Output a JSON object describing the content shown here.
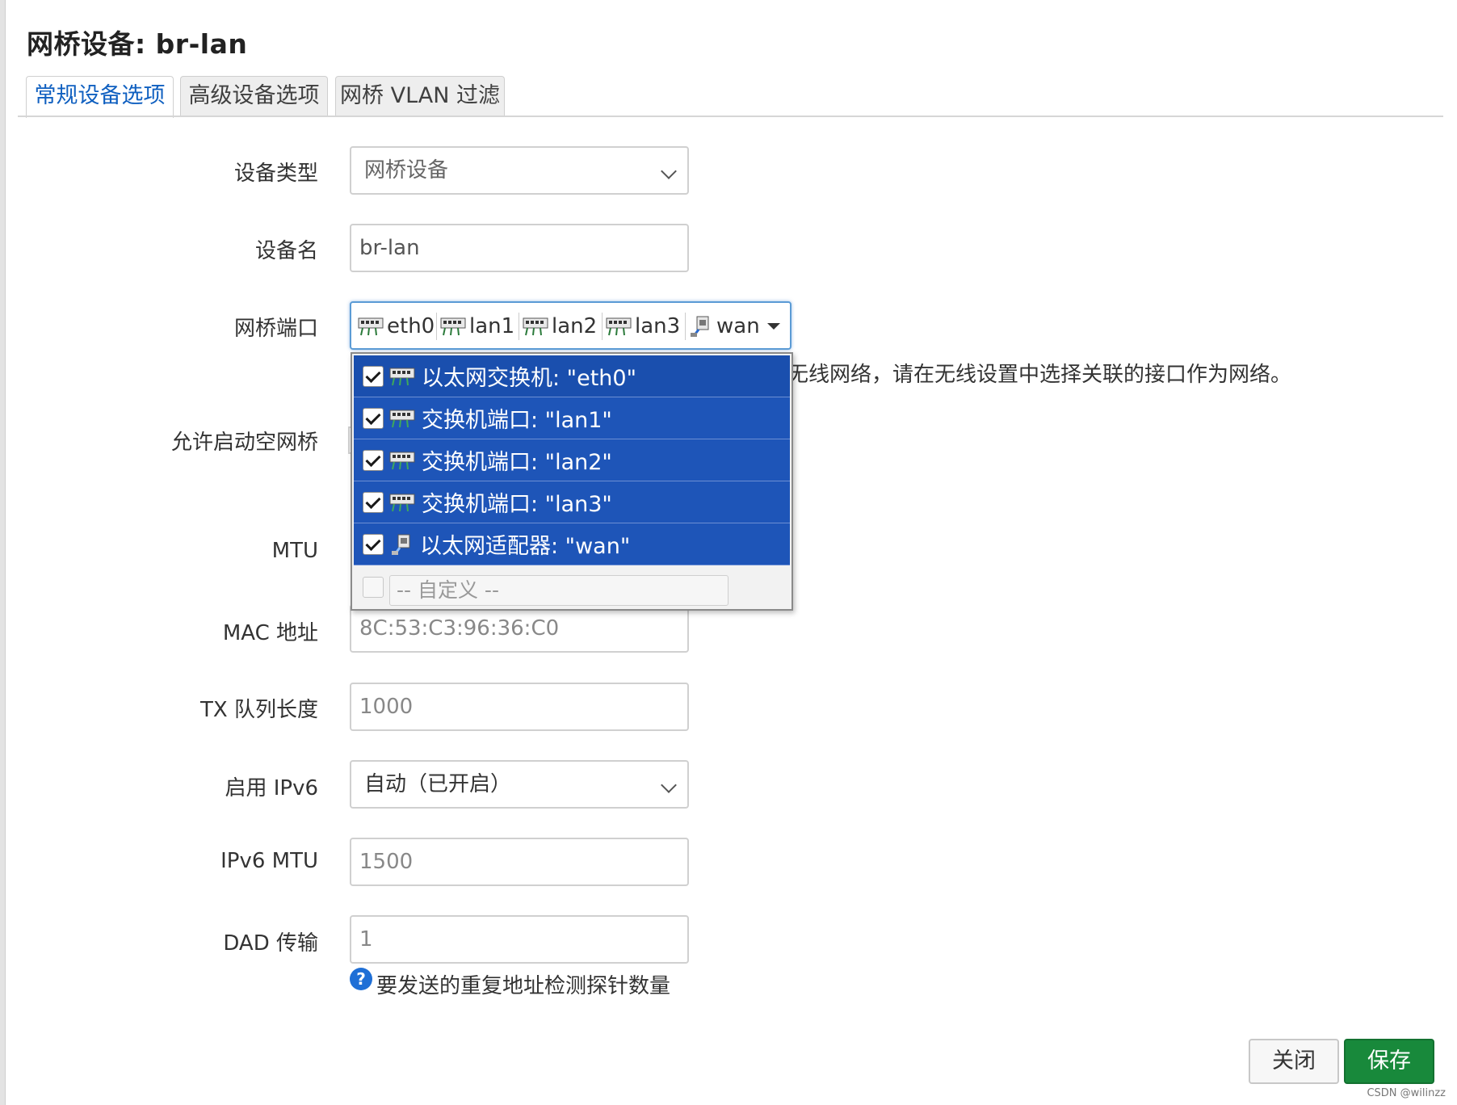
{
  "dialog": {
    "title": "网桥设备: br-lan"
  },
  "tabs": [
    {
      "label": "常规设备选项",
      "active": true
    },
    {
      "label": "高级设备选项",
      "active": false
    },
    {
      "label": "网桥 VLAN 过滤",
      "active": false
    }
  ],
  "form": {
    "device_type": {
      "label": "设备类型",
      "value": "网桥设备"
    },
    "device_name": {
      "label": "设备名",
      "value": "br-lan"
    },
    "bridge_ports": {
      "label": "网桥端口",
      "selected": [
        "eth0",
        "lan1",
        "lan2",
        "lan3",
        "wan"
      ],
      "hint": "无线网络，请在无线设置中选择关联的接口作为网络。"
    },
    "bring_up_empty": {
      "label": "允许启动空网桥"
    },
    "mtu": {
      "label": "MTU"
    },
    "mac_address": {
      "label": "MAC 地址",
      "placeholder": "8C:53:C3:96:36:C0"
    },
    "tx_queue": {
      "label": "TX 队列长度",
      "placeholder": "1000"
    },
    "enable_ipv6": {
      "label": "启用 IPv6",
      "value": "自动（已开启）"
    },
    "ipv6_mtu": {
      "label": "IPv6 MTU",
      "placeholder": "1500"
    },
    "dad_transmits": {
      "label": "DAD 传输",
      "placeholder": "1",
      "help": "要发送的重复地址检测探针数量"
    }
  },
  "dropdown": {
    "options": [
      {
        "label": "以太网交换机: \"eth0\"",
        "checked": true,
        "icon": "switch-icon"
      },
      {
        "label": "交换机端口: \"lan1\"",
        "checked": true,
        "icon": "switch-icon"
      },
      {
        "label": "交换机端口: \"lan2\"",
        "checked": true,
        "icon": "switch-icon"
      },
      {
        "label": "交换机端口: \"lan3\"",
        "checked": true,
        "icon": "switch-icon"
      },
      {
        "label": "以太网适配器: \"wan\"",
        "checked": true,
        "icon": "ethernet-adapter-icon"
      }
    ],
    "custom_placeholder": "-- 自定义 --"
  },
  "buttons": {
    "close": "关闭",
    "save": "保存"
  },
  "watermark": "CSDN @wilinzz",
  "colors": {
    "accent": "#1060c0",
    "selected_option": "#1e55b8",
    "save_button": "#18893b"
  }
}
